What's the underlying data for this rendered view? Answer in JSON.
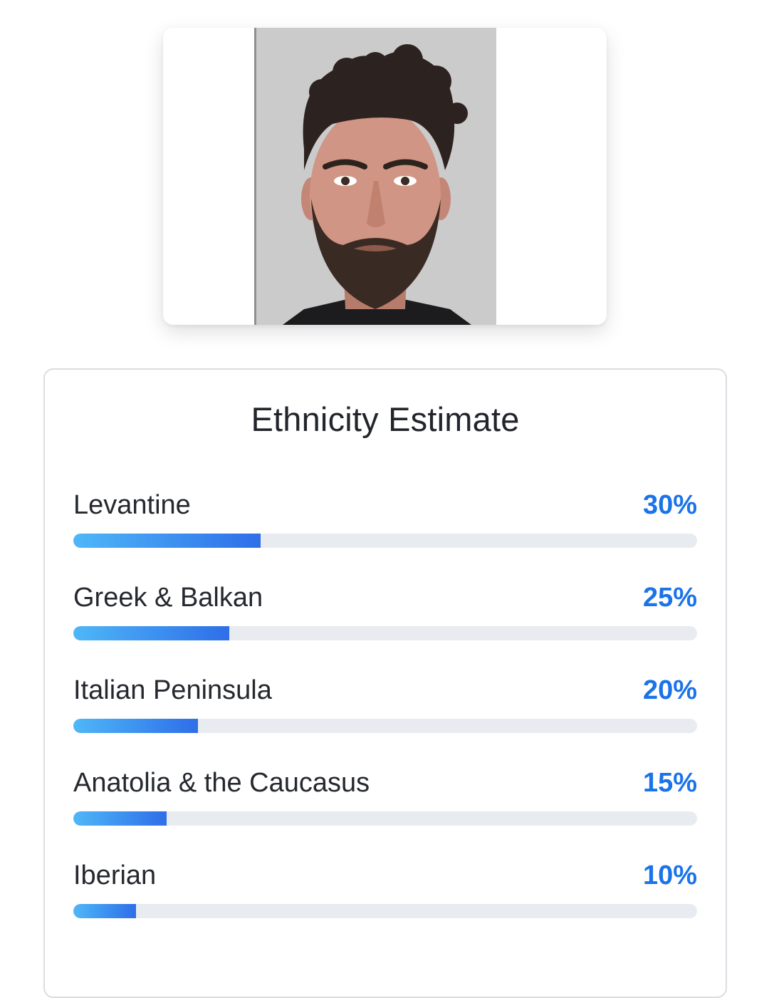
{
  "photo": {
    "alt": "Uploaded face photo"
  },
  "ethnicity": {
    "title": "Ethnicity Estimate",
    "accent_color": "#1a73e8",
    "items": [
      {
        "label": "Levantine",
        "value_text": "30%",
        "value": 30
      },
      {
        "label": "Greek & Balkan",
        "value_text": "25%",
        "value": 25
      },
      {
        "label": "Italian Peninsula",
        "value_text": "20%",
        "value": 20
      },
      {
        "label": "Anatolia & the Caucasus",
        "value_text": "15%",
        "value": 15
      },
      {
        "label": "Iberian",
        "value_text": "10%",
        "value": 10
      }
    ]
  }
}
